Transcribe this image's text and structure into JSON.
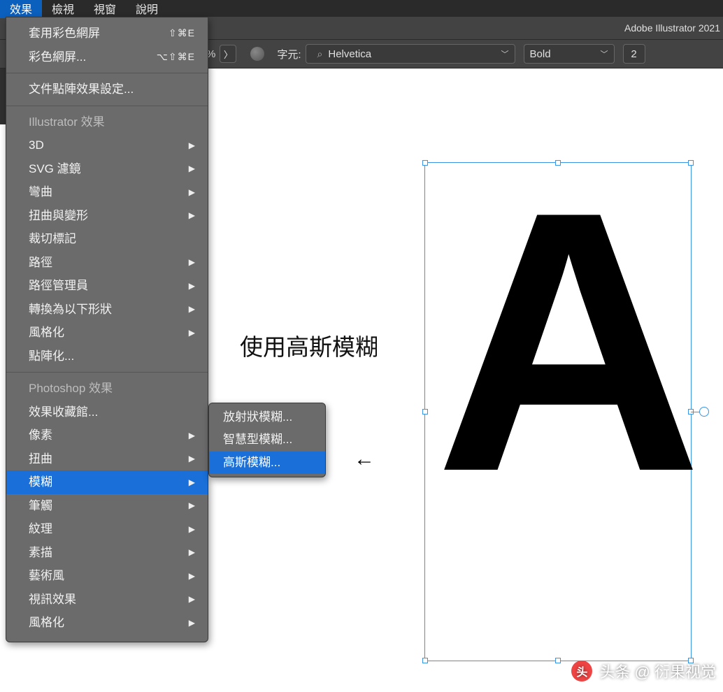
{
  "menubar": {
    "items": [
      "效果",
      "檢視",
      "視窗",
      "說明"
    ],
    "active_index": 0
  },
  "titlebar": {
    "app": "Adobe Illustrator 2021"
  },
  "options_bar": {
    "opacity_pct": "%",
    "chevron": "〉",
    "font_label": "字元:",
    "search_icon": "⌕",
    "font_family": "Helvetica",
    "font_weight": "Bold",
    "font_size": "2"
  },
  "effects_menu": {
    "top": [
      {
        "label": "套用彩色網屏",
        "shortcut": "⇧⌘E"
      },
      {
        "label": "彩色網屏...",
        "shortcut": "⌥⇧⌘E"
      }
    ],
    "raster": {
      "label": "文件點陣效果設定..."
    },
    "section_ai": "Illustrator 效果",
    "ai_items": [
      {
        "label": "3D",
        "submenu": true
      },
      {
        "label": "SVG 濾鏡",
        "submenu": true
      },
      {
        "label": "彎曲",
        "submenu": true
      },
      {
        "label": "扭曲與變形",
        "submenu": true
      },
      {
        "label": "裁切標記",
        "submenu": false
      },
      {
        "label": "路徑",
        "submenu": true
      },
      {
        "label": "路徑管理員",
        "submenu": true
      },
      {
        "label": "轉換為以下形狀",
        "submenu": true
      },
      {
        "label": "風格化",
        "submenu": true
      },
      {
        "label": "點陣化...",
        "submenu": false
      }
    ],
    "section_ps": "Photoshop 效果",
    "ps_items": [
      {
        "label": "效果收藏館...",
        "submenu": false
      },
      {
        "label": "像素",
        "submenu": true
      },
      {
        "label": "扭曲",
        "submenu": true
      },
      {
        "label": "模糊",
        "submenu": true,
        "highlight": true
      },
      {
        "label": "筆觸",
        "submenu": true
      },
      {
        "label": "紋理",
        "submenu": true
      },
      {
        "label": "素描",
        "submenu": true
      },
      {
        "label": "藝術風",
        "submenu": true
      },
      {
        "label": "視訊效果",
        "submenu": true
      },
      {
        "label": "風格化",
        "submenu": true
      }
    ]
  },
  "blur_submenu": {
    "items": [
      {
        "label": "放射狀模糊..."
      },
      {
        "label": "智慧型模糊..."
      },
      {
        "label": "高斯模糊...",
        "highlight": true
      }
    ]
  },
  "canvas": {
    "letter": "A",
    "annotation": "使用高斯模糊",
    "arrow": "←"
  },
  "watermark": {
    "logo": "头",
    "text": "头条 @ 衍果视觉"
  }
}
